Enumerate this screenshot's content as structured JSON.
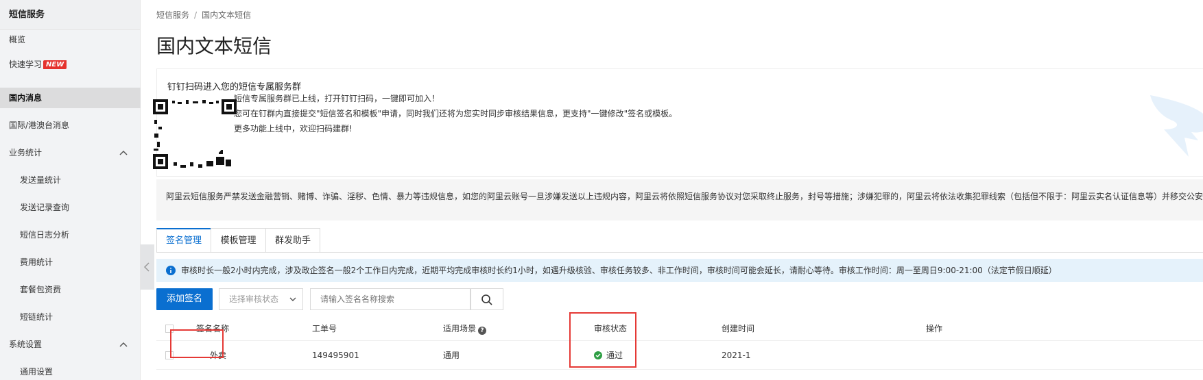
{
  "sidebar": {
    "title": "短信服务",
    "items": [
      {
        "label": "概览"
      },
      {
        "label": "快速学习",
        "badge": "NEW"
      },
      {
        "label": "国内消息"
      },
      {
        "label": "国际/港澳台消息"
      },
      {
        "label": "业务统计"
      },
      {
        "label": "发送量统计"
      },
      {
        "label": "发送记录查询"
      },
      {
        "label": "短信日志分析"
      },
      {
        "label": "费用统计"
      },
      {
        "label": "套餐包资费"
      },
      {
        "label": "短链统计"
      },
      {
        "label": "系统设置"
      },
      {
        "label": "通用设置"
      }
    ]
  },
  "breadcrumb": {
    "root": "短信服务",
    "sep": "/",
    "current": "国内文本短信"
  },
  "page_title": "国内文本短信",
  "dingtalk_panel": {
    "heading": "钉钉扫码进入您的短信专属服务群",
    "lines": [
      "短信专属服务群已上线，打开钉钉扫码，一键即可加入！",
      "您可在钉群内直接提交\"短信签名和模板\"申请，同时我们还将为您实时同步审核结果信息，更支持\"一键修改\"签名或模板。",
      "更多功能上线中，欢迎扫码建群!"
    ]
  },
  "notice_text": "阿里云短信服务严禁发送金融营销、赌博、诈骗、淫秽、色情、暴力等违规信息，如您的阿里云账号一旦涉嫌发送以上违规内容，阿里云将依照短信服务协议对您采取终止服务，封号等措施；涉嫌犯罪的，阿里云将依法收集犯罪线索（包括但不限于：阿里云实名认证信息等）并移交公安",
  "tabs": [
    "签名管理",
    "模板管理",
    "群发助手"
  ],
  "info_text": "审核时长一般2小时内完成，涉及政企签名一般2个工作日内完成，近期平均完成审核时长约1小时，如遇升级核验、审核任务较多、非工作时间，审核时间可能会延长，请耐心等待。审核工作时间：周一至周日9:00-21:00（法定节假日顺延）",
  "toolbar": {
    "add_label": "添加签名",
    "status_placeholder": "选择审核状态",
    "search_placeholder": "请输入签名名称搜索"
  },
  "table": {
    "headers": [
      "签名名称",
      "工单号",
      "适用场景",
      "审核状态",
      "创建时间",
      "操作"
    ],
    "rows": [
      {
        "name": "外卖",
        "ticket": "149495901",
        "scene": "通用",
        "status": "通过",
        "created": "2021-1"
      }
    ]
  },
  "colors": {
    "primary": "#0a6fd0",
    "highlight": "#e53935",
    "success": "#2e9e44",
    "badge": "#e5322d"
  }
}
